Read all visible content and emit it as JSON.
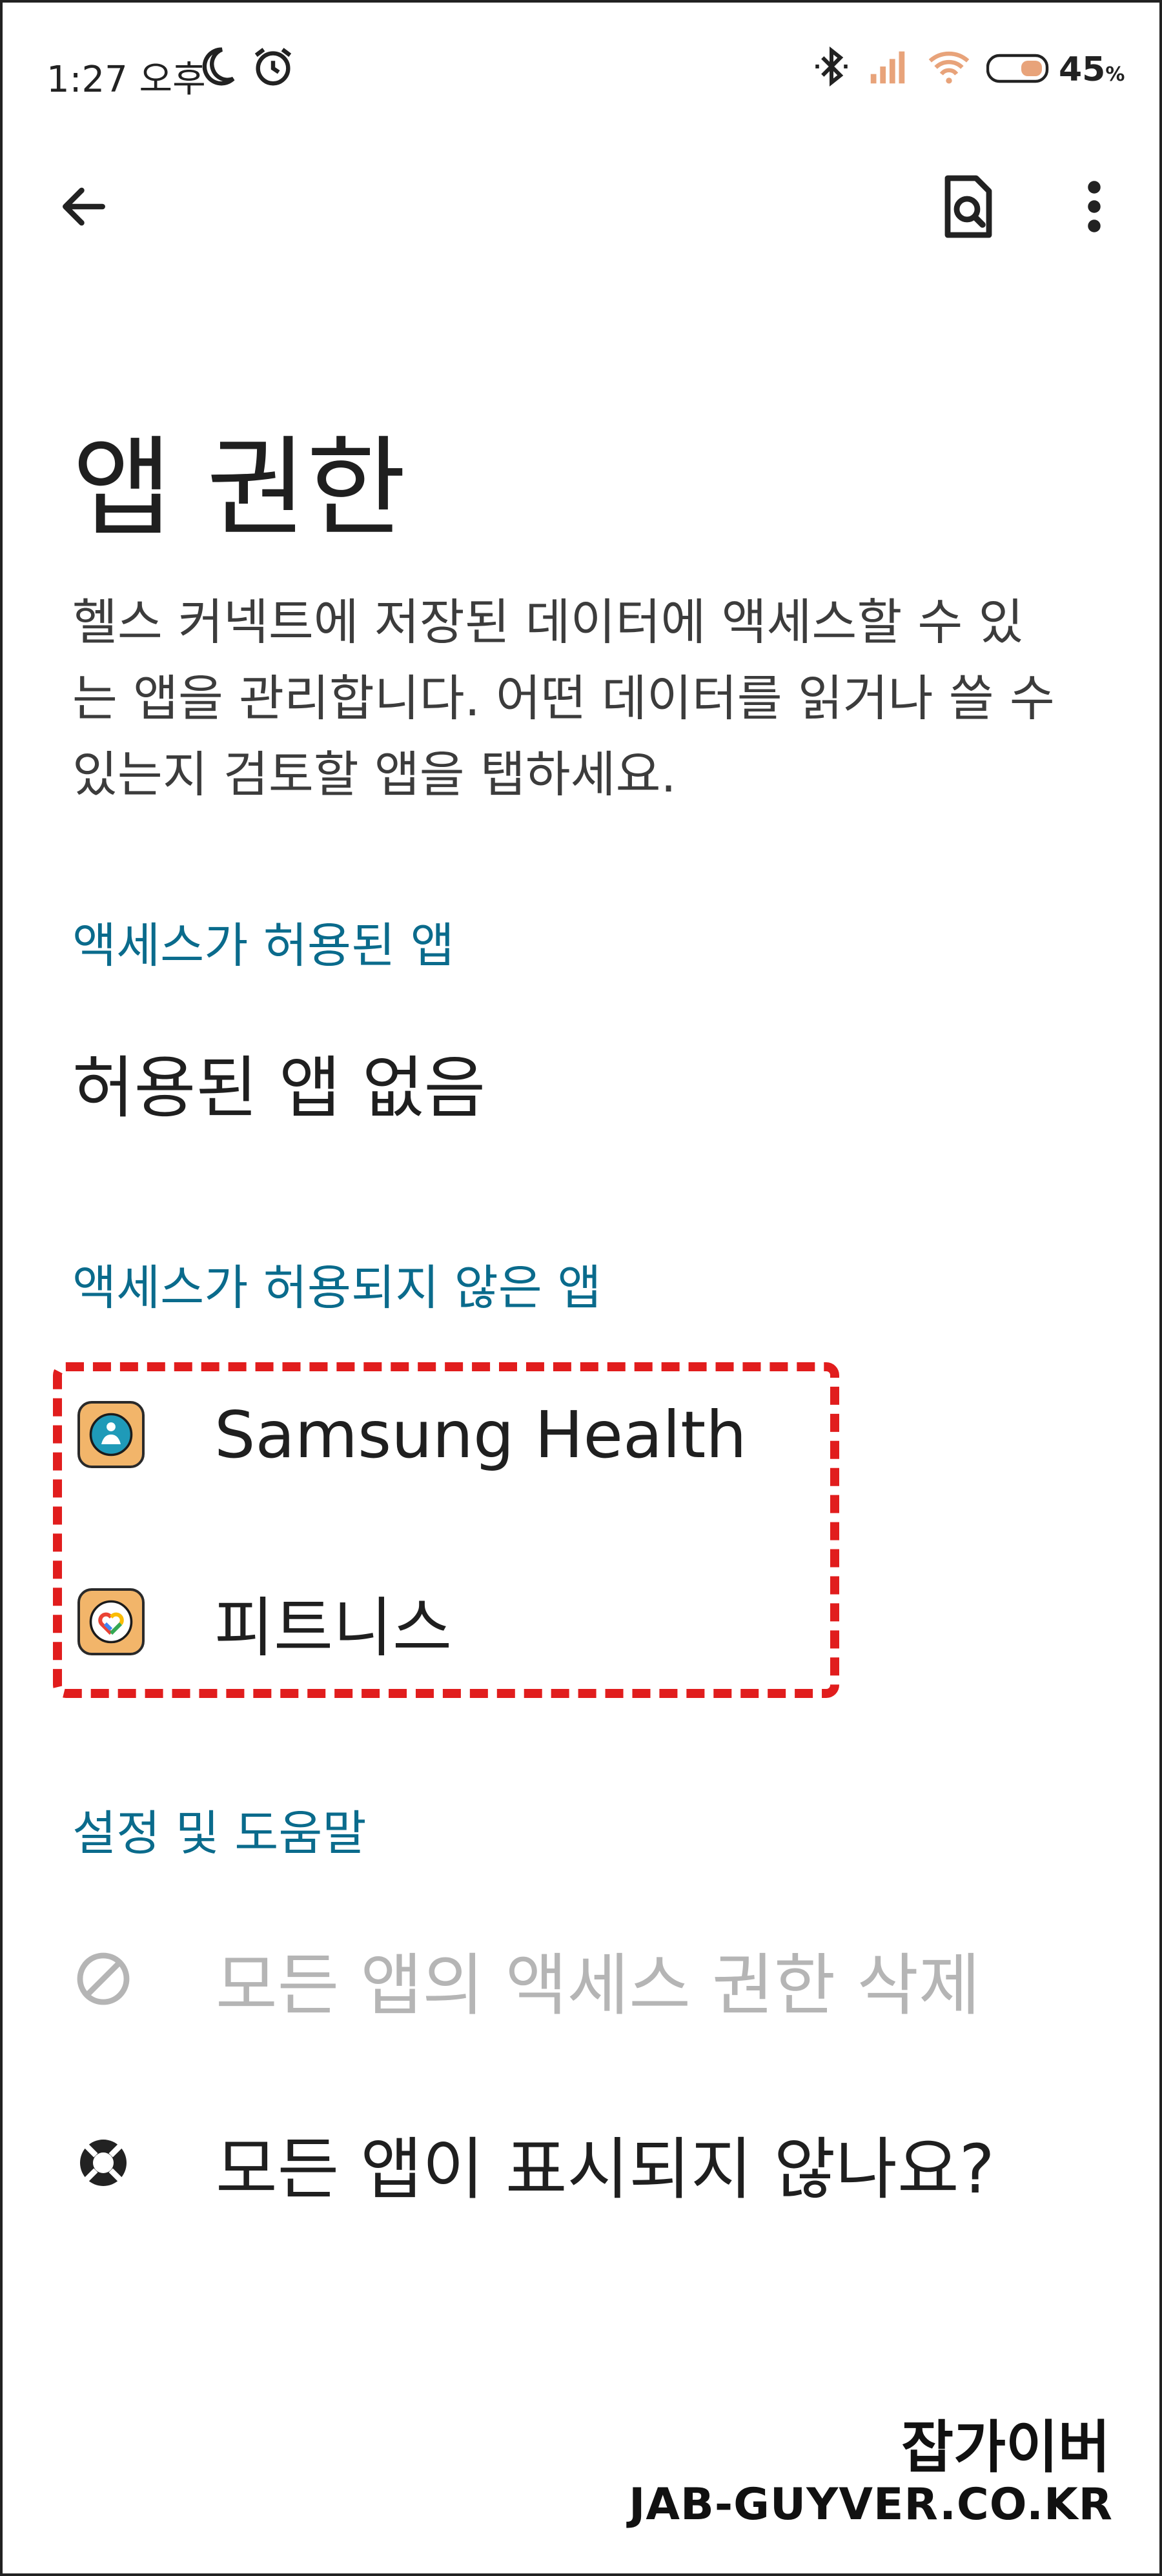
{
  "status_bar": {
    "time": "1:27 오후",
    "battery_percent": "45",
    "battery_unit": "%",
    "icons": [
      "moon-icon",
      "alarm-icon",
      "bluetooth-icon",
      "signal-icon",
      "wifi-icon",
      "battery-icon"
    ]
  },
  "toolbar": {
    "back_icon": "arrow-left-icon",
    "search_doc_icon": "document-search-icon",
    "more_icon": "more-vert-icon"
  },
  "page": {
    "title": "앱 권한",
    "description_lines": [
      "헬스 커넥트에 저장된 데이터에 액세스할 수 있",
      "는 앱을 관리합니다. 어떤 데이터를 읽거나 쓸 수",
      "있는지 검토할 앱을 탭하세요."
    ]
  },
  "sections": {
    "allowed_header": "액세스가 허용된 앱",
    "allowed_empty": "허용된 앱 없음",
    "not_allowed_header": "액세스가 허용되지 않은 앱",
    "not_allowed_apps": [
      {
        "label": "Samsung Health",
        "icon": "samsung-health-icon"
      },
      {
        "label": "피트니스",
        "icon": "google-fit-icon"
      }
    ],
    "settings_header": "설정 및 도움말",
    "settings_items": [
      {
        "label": "모든 앱의 액세스 권한 삭제",
        "icon": "block-icon",
        "disabled": true
      },
      {
        "label": "모든 앱이 표시되지 않나요?",
        "icon": "help-lifebuoy-icon",
        "disabled": false
      }
    ]
  },
  "colors": {
    "section_header": "#0a6b8c",
    "highlight": "#e11d1d",
    "disabled_text": "#b5b5b5",
    "app_icon_bg": "#f2b56a"
  },
  "watermark": {
    "korean": "잡가이버",
    "url": "JAB-GUYVER.CO.KR"
  }
}
